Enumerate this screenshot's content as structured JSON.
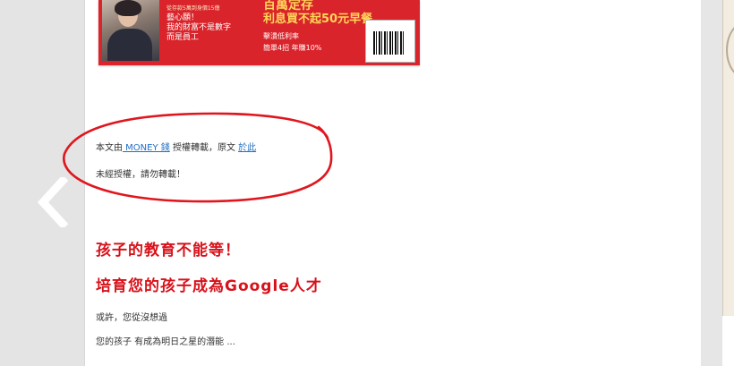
{
  "banner": {
    "small_text": "從存款5萬到身價15億",
    "left_lines": [
      "藝心願！",
      "我的財富不是數字",
      "而是員工"
    ],
    "headline_1": "百萬定存",
    "headline_2": "利息買不起50元早餐",
    "sub_1": "擊潰低利率",
    "sub_2": "簡單4招 年賺10%"
  },
  "attribution": {
    "prefix": "本文由",
    "source_link": " MONEY 錢",
    "middle": " 授權轉載，原文 ",
    "original_link": "於此",
    "notice": "未經授權，請勿轉載！"
  },
  "promo": {
    "heading_1": "孩子的教育不能等！",
    "heading_2": "培育您的孩子成為Google人才",
    "line_1": "或許，您從沒想過",
    "line_2": "您的孩子 有成為明日之星的潛能 ..."
  },
  "colors": {
    "accent_red": "#d8121b",
    "link_blue": "#1f6fc4",
    "annotation_red": "#e0161e"
  }
}
